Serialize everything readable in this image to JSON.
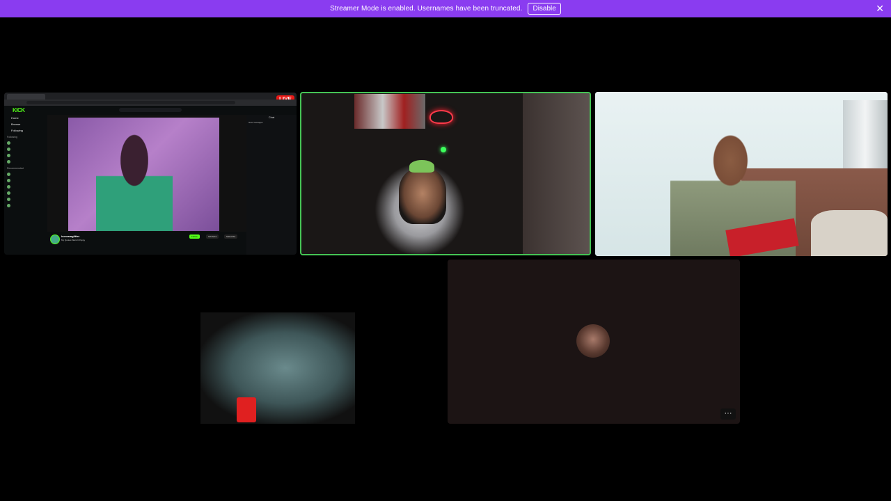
{
  "banner": {
    "message": "Streamer Mode is enabled. Usernames have been truncated.",
    "disable_label": "Disable",
    "close_icon": "close-icon",
    "color": "#8a3cf0"
  },
  "tiles": {
    "screen_share": {
      "live_badge": "LIVE",
      "kick_logo": "KICK",
      "sidebar": {
        "nav": [
          "Home",
          "Browse",
          "Following"
        ],
        "following_heading": "Following",
        "recommended_heading": "Recommended"
      },
      "chat_title": "Chat",
      "new_messages": "New messages",
      "stream": {
        "channel": "iscreamglitter",
        "title": "My Quotes Want It Poppy",
        "follow_label": "Follow",
        "gift_label": "Gift Subs",
        "subscribe_label": "Subscribe"
      }
    },
    "speaking_color": "#45c455",
    "more_options_icon": "more-horizontal-icon",
    "more_options_label": "···"
  }
}
